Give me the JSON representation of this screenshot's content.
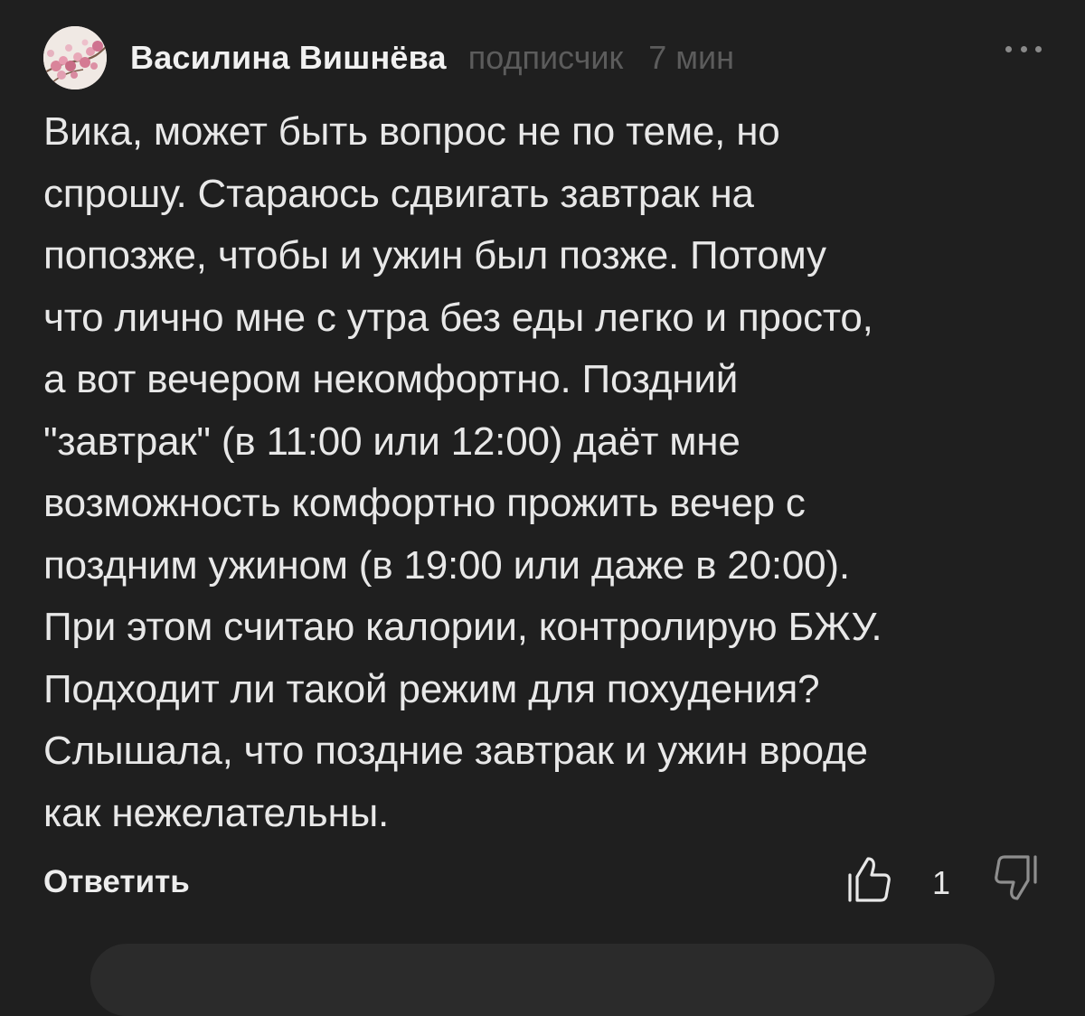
{
  "comment": {
    "author": "Василина Вишнёва",
    "role": "подписчик",
    "time": "7 мин",
    "text": "Вика, может быть вопрос не по теме, но\nспрошу. Стараюсь сдвигать завтрак на\nпопозже, чтобы и ужин был позже. Потому\nчто лично мне с утра без еды легко и просто,\nа вот вечером некомфортно. Поздний\n\"завтрак\" (в 11:00 или 12:00) даёт мне\nвозможность комфортно прожить вечер с\nпоздним ужином (в 19:00 или даже в 20:00).\nПри этом считаю калории, контролирую БЖУ.\nПодходит ли такой режим для похудения?\nСлышала, что поздние завтрак и ужин вроде\nкак нежелательны.",
    "reply_label": "Ответить",
    "like_count": "1",
    "icons": {
      "more": "more-dots-icon",
      "like": "thumbs-up-icon",
      "dislike": "thumbs-down-icon"
    }
  }
}
